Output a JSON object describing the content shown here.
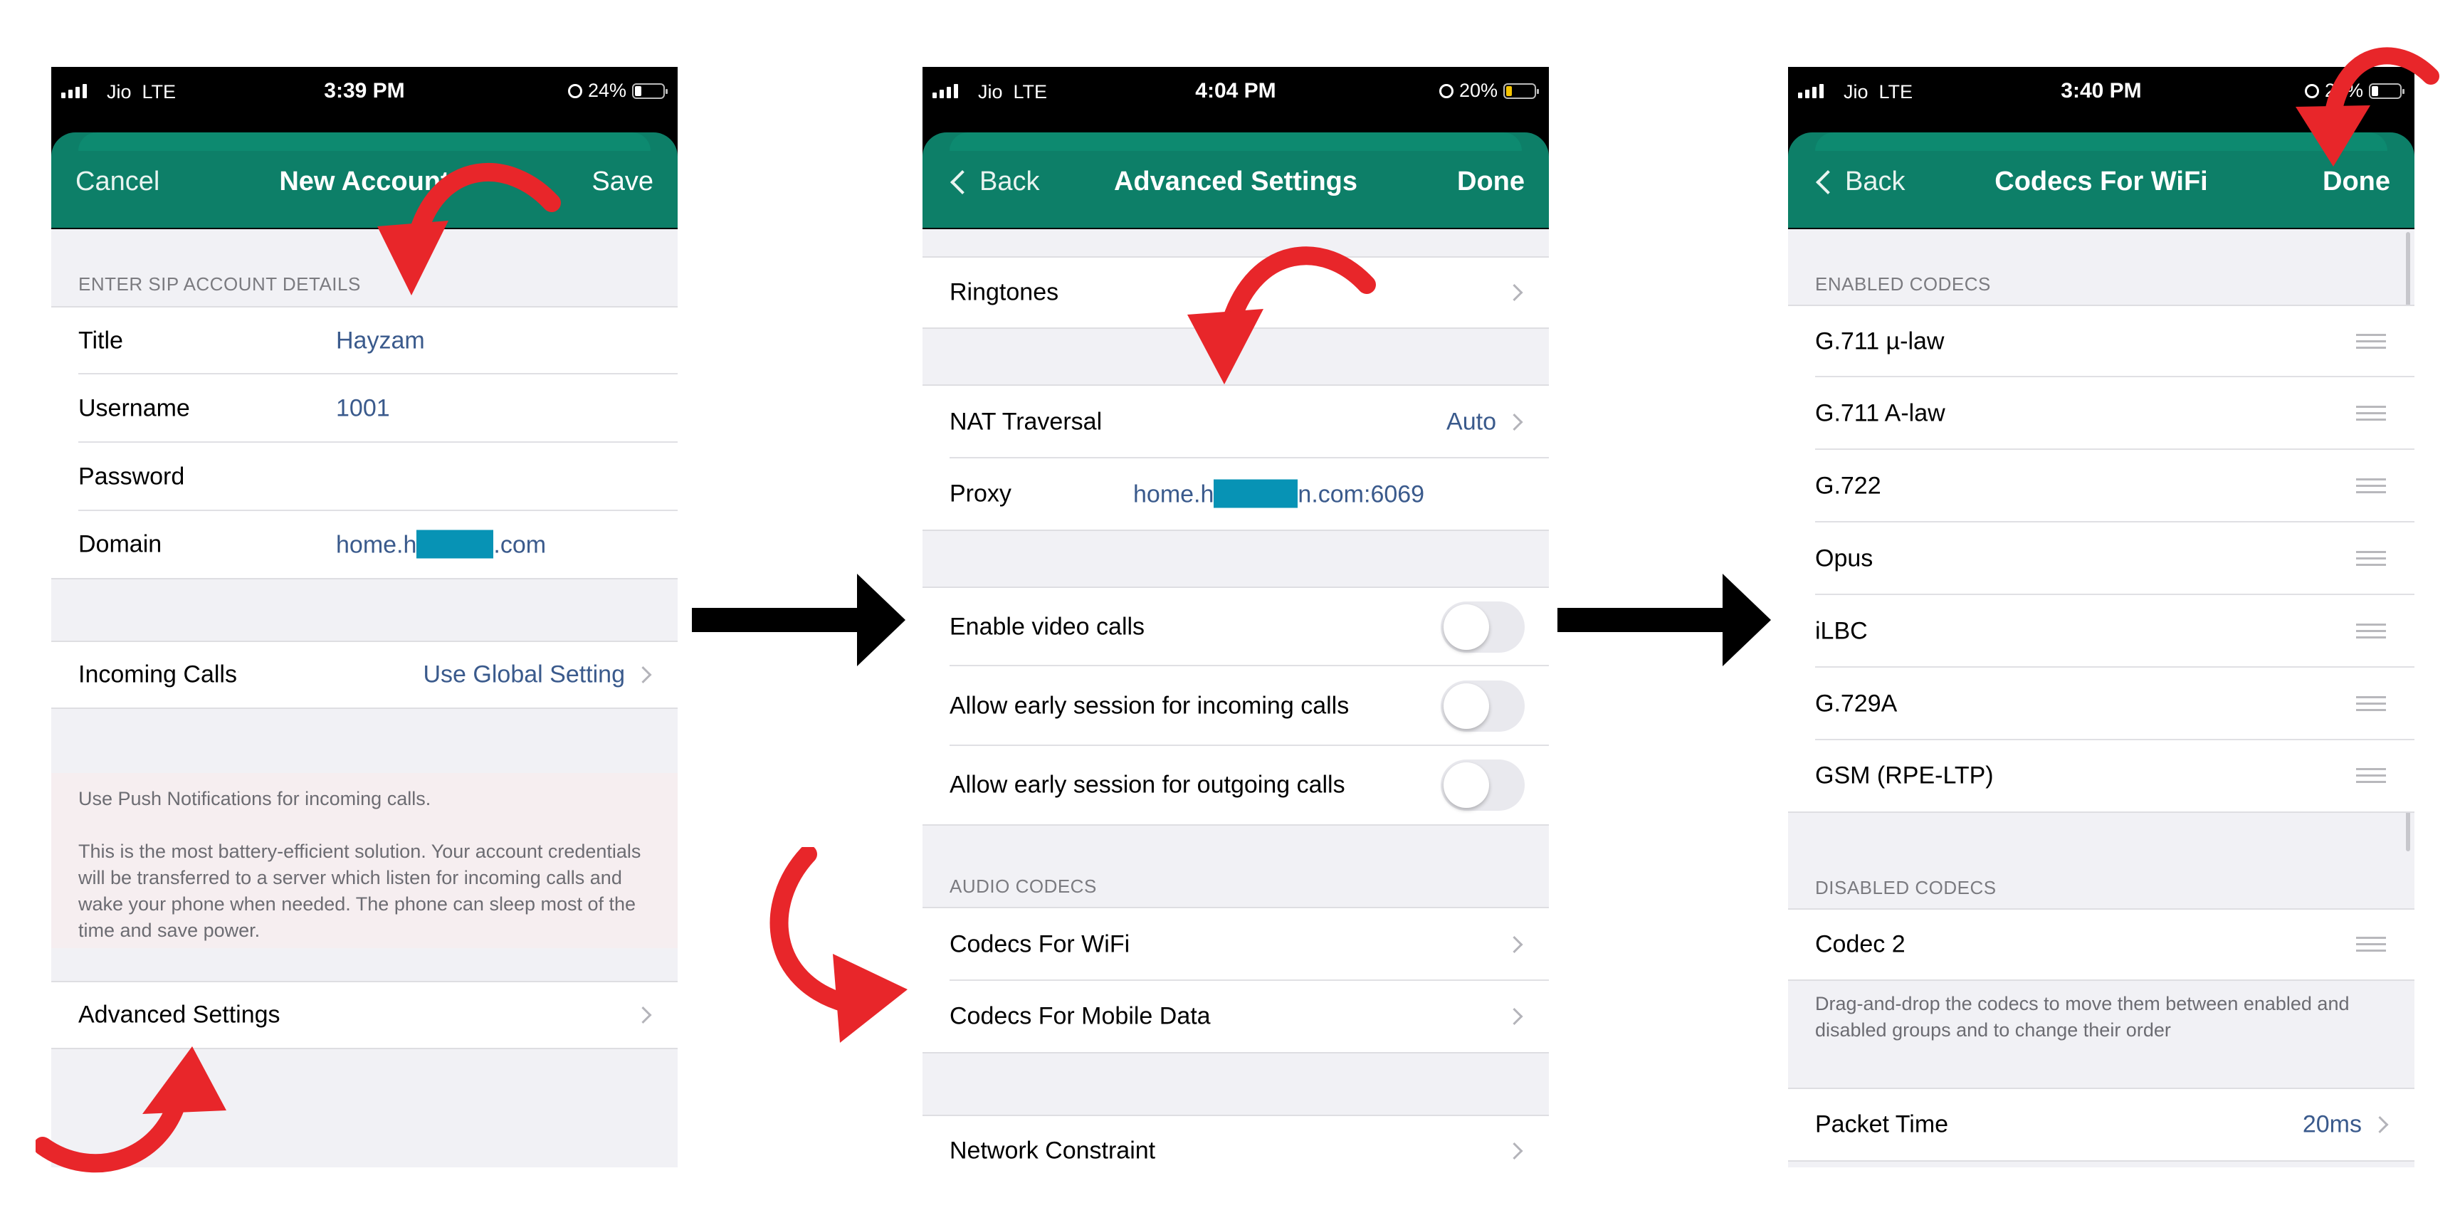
{
  "screens": [
    {
      "status": {
        "carrier": "Jio",
        "network": "LTE",
        "time": "3:39 PM",
        "battery": "24%",
        "battery_level": 0.24
      },
      "nav": {
        "left": "Cancel",
        "title": "New Account",
        "right": "Save"
      },
      "section_sip": "ENTER SIP ACCOUNT DETAILS",
      "fields": [
        {
          "label": "Title",
          "value": "Hayzam"
        },
        {
          "label": "Username",
          "value": "1001"
        },
        {
          "label": "Password",
          "value": ""
        },
        {
          "label": "Domain",
          "value_prefix": "home.h",
          "value_suffix": ".com"
        }
      ],
      "incoming": {
        "label": "Incoming Calls",
        "value": "Use Global Setting"
      },
      "push_note_1": "Use Push Notifications for incoming calls.",
      "push_note_2": "This is the most battery-efficient solution. Your account credentials will be transferred to a server which listen for incoming calls and wake your phone when needed. The phone can sleep most of the time and save power.",
      "advanced": "Advanced Settings"
    },
    {
      "status": {
        "carrier": "Jio",
        "network": "LTE",
        "time": "4:04 PM",
        "battery": "20%",
        "battery_level": 0.2
      },
      "nav": {
        "left": "Back",
        "title": "Advanced Settings",
        "right": "Done"
      },
      "ringtones": "Ringtones",
      "nat": {
        "label": "NAT Traversal",
        "value": "Auto"
      },
      "proxy": {
        "label": "Proxy",
        "value_prefix": "home.h",
        "value_suffix": "n.com:6069"
      },
      "toggles": [
        {
          "label": "Enable video calls",
          "on": false
        },
        {
          "label": "Allow early session for incoming calls",
          "on": false
        },
        {
          "label": "Allow early session for outgoing calls",
          "on": false
        }
      ],
      "section_audio": "AUDIO CODECS",
      "codec_links": [
        "Codecs For WiFi",
        "Codecs For Mobile Data"
      ],
      "network_constraint": "Network Constraint"
    },
    {
      "status": {
        "carrier": "Jio",
        "network": "LTE",
        "time": "3:40 PM",
        "battery": "24%",
        "battery_level": 0.24
      },
      "nav": {
        "left": "Back",
        "title": "Codecs For WiFi",
        "right": "Done"
      },
      "section_enabled": "ENABLED CODECS",
      "enabled_codecs": [
        "G.711 µ-law",
        "G.711 A-law",
        "G.722",
        "Opus",
        "iLBC",
        "G.729A",
        "GSM (RPE-LTP)"
      ],
      "section_disabled": "DISABLED CODECS",
      "disabled_codecs": [
        "Codec 2"
      ],
      "drag_note": "Drag-and-drop the codecs to move them between enabled and disabled groups and to change their order",
      "packet_time": {
        "label": "Packet Time",
        "value": "20ms"
      }
    }
  ],
  "colors": {
    "nav": "#0d7f68",
    "link_value": "#3a5a8c",
    "annotation_arrow": "#e8262a",
    "flow_arrow": "#000000",
    "redaction": "#0793b5"
  }
}
